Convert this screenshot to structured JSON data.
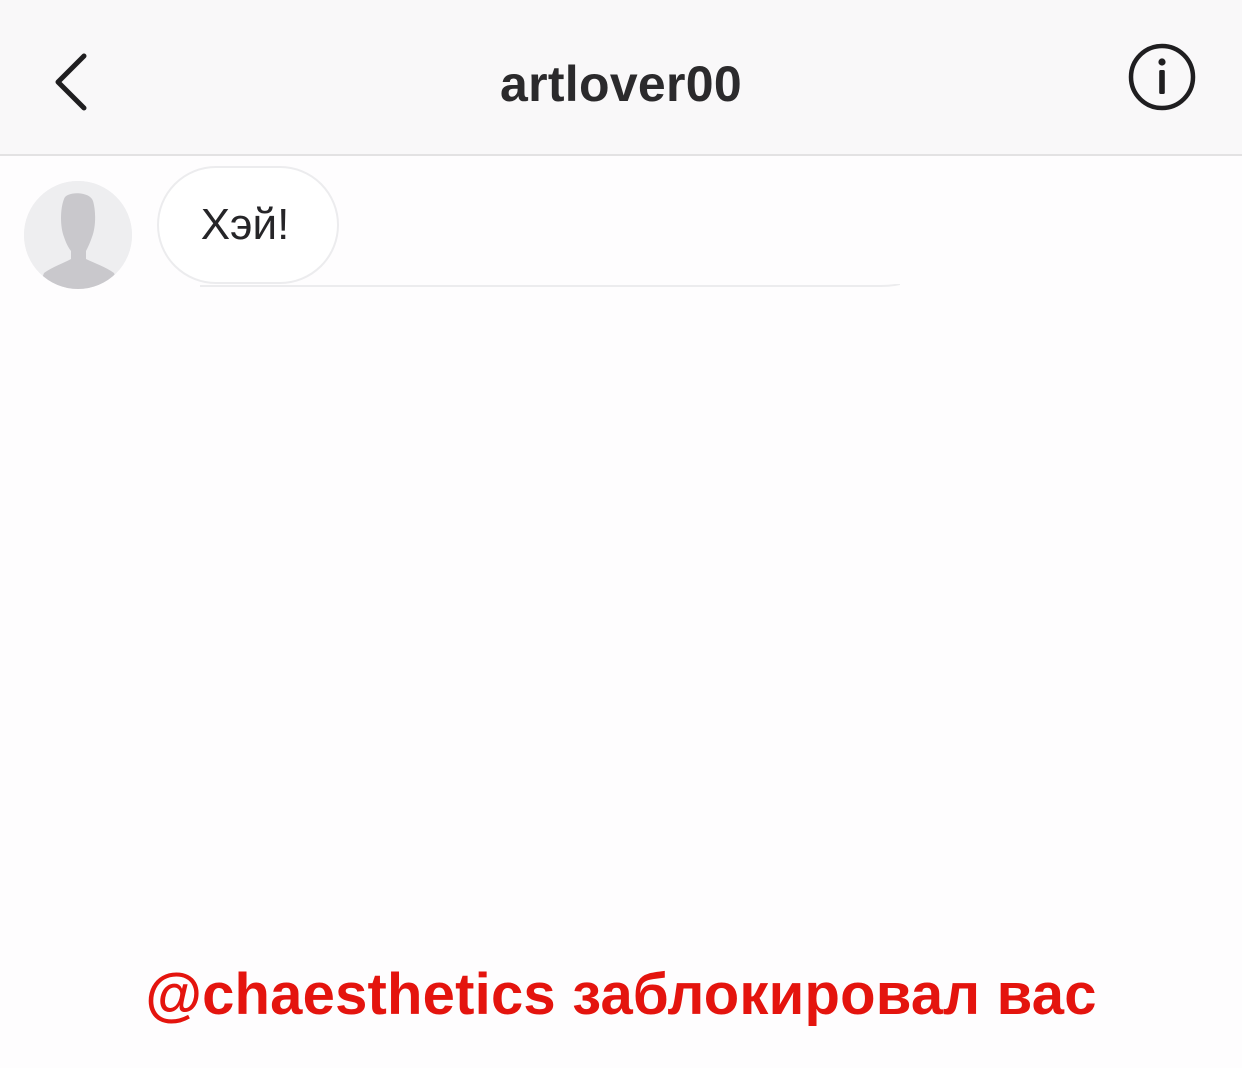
{
  "header": {
    "title": "artlover00",
    "back_icon": "chevron-left-icon",
    "info_icon": "info-circle-icon"
  },
  "conversation": {
    "messages": [
      {
        "sender": "artlover00",
        "text": "Хэй!",
        "avatar_icon": "default-avatar-silhouette"
      }
    ]
  },
  "overlay": {
    "blocked_text": "@chaesthetics заблокировал вас",
    "color": "#e4140e"
  },
  "colors": {
    "header_bg": "#f9f8f9",
    "title": "#2b2a2c",
    "bubble_border": "#ececee",
    "avatar_bg": "#eeeef0",
    "avatar_silhouette": "#c9c8cc"
  }
}
